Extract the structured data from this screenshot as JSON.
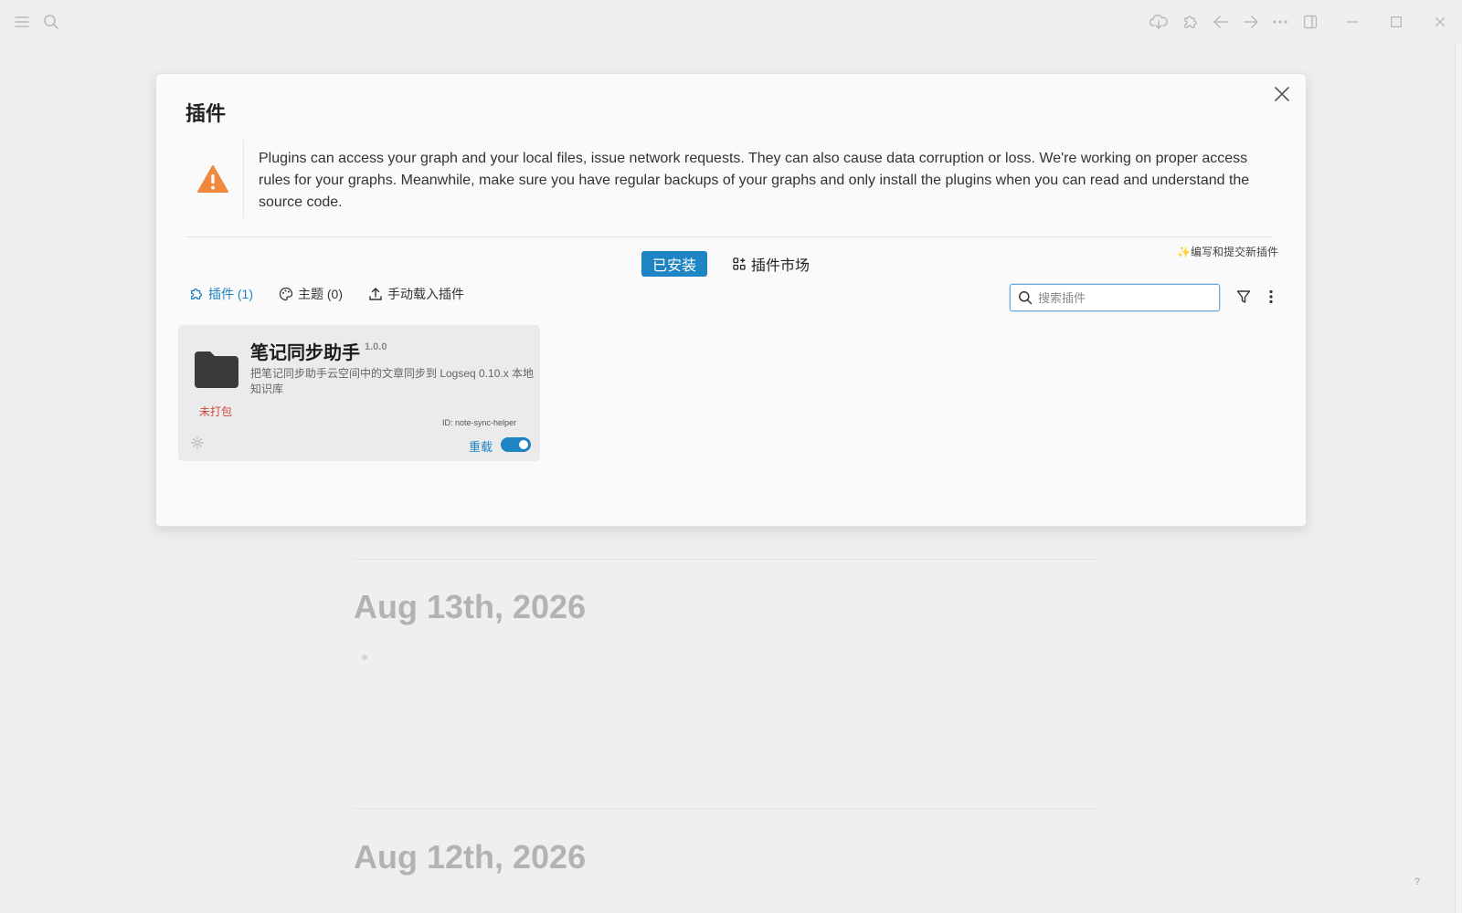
{
  "journal": {
    "entries": [
      {
        "date": "Aug 13th, 2026"
      },
      {
        "date": "Aug 12th, 2026"
      }
    ],
    "help_label": "?"
  },
  "plugins_dialog": {
    "title": "插件",
    "warning": "Plugins can access your graph and your local files, issue network requests. They can also cause data corruption or loss. We're working on proper access rules for your graphs. Meanwhile, make sure you have regular backups of your graphs and only install the plugins when you can read and understand the source code.",
    "tabs": {
      "installed": "已安装",
      "marketplace": "插件市场"
    },
    "submit_link": "✨编写和提交新插件",
    "filters": {
      "plugins": "插件 (1)",
      "themes": "主题 (0)",
      "load_unpacked": "手动载入插件"
    },
    "search": {
      "placeholder": "搜索插件",
      "value": ""
    },
    "plugin": {
      "name": "笔记同步助手",
      "version": "1.0.0",
      "description": "把笔记同步助手云空间中的文章同步到 Logseq 0.10.x 本地知识库",
      "id_text": "ID: note-sync-helper",
      "status": "未打包",
      "reload_label": "重载",
      "enabled": true
    }
  },
  "colors": {
    "accent": "#1f84c4",
    "warning": "#f0883e",
    "unpacked": "#d2453c"
  }
}
